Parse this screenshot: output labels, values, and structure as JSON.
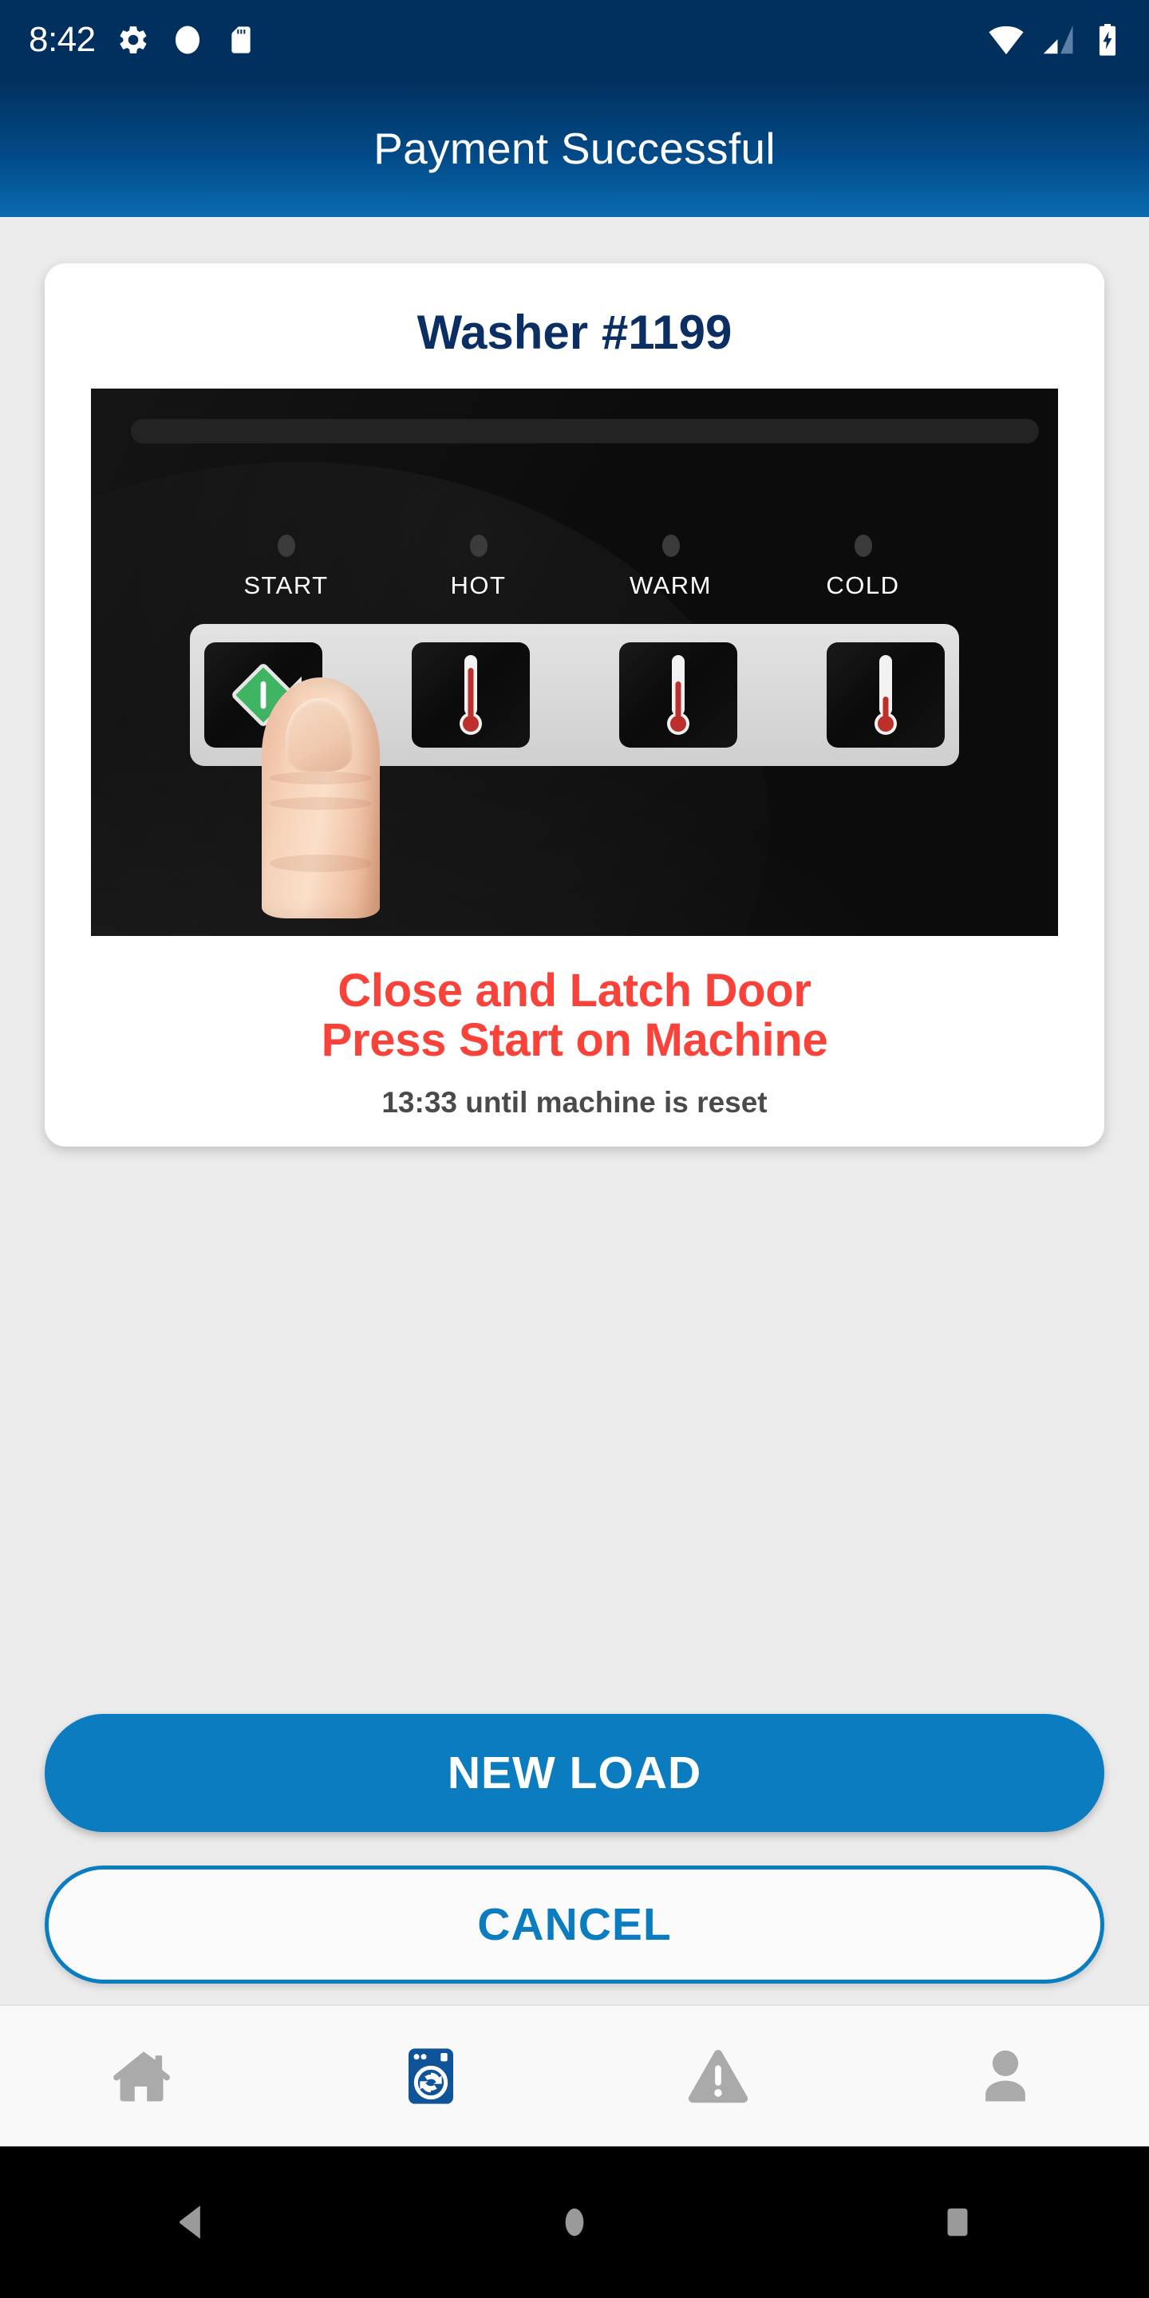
{
  "status_bar": {
    "time": "8:42",
    "left_icons": [
      "gear-icon",
      "circle-icon",
      "sd-card-icon"
    ],
    "right_icons": [
      "wifi-icon",
      "cellular-signal-icon",
      "battery-charging-icon"
    ],
    "background_color": "#02305e"
  },
  "header": {
    "title": "Payment Successful",
    "gradient_top": "#02305e",
    "gradient_bottom": "#0a6bb0"
  },
  "card": {
    "machine_title": "Washer #1199",
    "title_color": "#0c2f63",
    "photo": {
      "alt": "washing-machine-control-panel-photo",
      "background_color": "#0c0c0c",
      "panel_color": "#d6d6d6",
      "controls": [
        {
          "label": "START",
          "icon": "green-diamond-start-icon",
          "color": "#3fb463",
          "fill_percent": 100
        },
        {
          "label": "HOT",
          "icon": "thermometer-icon",
          "color": "#c0302c",
          "fill_percent": 75
        },
        {
          "label": "WARM",
          "icon": "thermometer-icon",
          "color": "#c0302c",
          "fill_percent": 55
        },
        {
          "label": "COLD",
          "icon": "thermometer-icon",
          "color": "#c0302c",
          "fill_percent": 32
        }
      ],
      "finger_overlay": "finger-pressing-start-button"
    },
    "instruction_line_1": "Close and Latch Door",
    "instruction_line_2": "Press Start on Machine",
    "instruction_color": "#f8423a",
    "timer_text": "13:33 until machine is reset",
    "timer_color": "#4a4a4a"
  },
  "actions": {
    "primary_label": "NEW LOAD",
    "primary_color": "#0c7cc0",
    "secondary_label": "CANCEL",
    "secondary_color": "#0c7cc0"
  },
  "tab_bar": {
    "active_color": "#0f5499",
    "inactive_color": "#aaaaaa",
    "tabs": [
      {
        "name": "home",
        "icon": "home-icon",
        "active": false
      },
      {
        "name": "machines",
        "icon": "washing-machine-icon",
        "active": true
      },
      {
        "name": "alerts",
        "icon": "warning-triangle-icon",
        "active": false
      },
      {
        "name": "account",
        "icon": "person-icon",
        "active": false
      }
    ]
  },
  "system_nav": {
    "buttons": [
      {
        "name": "back",
        "icon": "back-triangle-icon"
      },
      {
        "name": "home",
        "icon": "home-circle-icon"
      },
      {
        "name": "recents",
        "icon": "recents-square-icon"
      }
    ],
    "color": "#9a9a9a",
    "background": "#000000"
  }
}
